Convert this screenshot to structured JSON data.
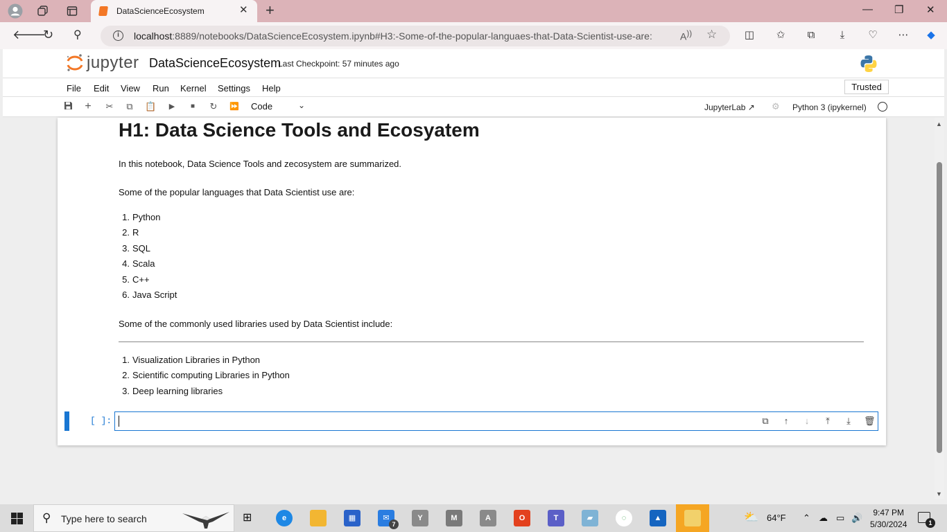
{
  "browser": {
    "tab_title": "DataScienceEcosystem",
    "url_host": "localhost",
    "url_rest": ":8889/notebooks/DataScienceEcosystem.ipynb#H3:-Some-of-the-popular-languaes-that-Data-Scientist-use-are:"
  },
  "jupyter": {
    "logo_word": "jupyter",
    "notebook_name": "DataScienceEcosystem",
    "checkpoint": "Last Checkpoint: 57 minutes ago",
    "menu": [
      "File",
      "Edit",
      "View",
      "Run",
      "Kernel",
      "Settings",
      "Help"
    ],
    "trusted": "Trusted",
    "cell_type": "Code",
    "jupyterlab_link": "JupyterLab",
    "kernel": "Python 3 (ipykernel)"
  },
  "notebook": {
    "title": "H1: Data Science Tools and Ecosyatem",
    "intro": "In this notebook, Data Science Tools and zecosystem are summarized.",
    "languages_heading": "Some of the popular languages that Data Scientist use are:",
    "languages": [
      "Python",
      "R",
      "SQL",
      "Scala",
      "C++",
      "Java Script"
    ],
    "libraries_heading": "Some of the commonly used libraries used by Data Scientist include:",
    "libraries": [
      "Visualization Libraries in Python",
      "Scientific computing Libraries in Python",
      "Deep learning libraries"
    ],
    "prompt": "[ ]:"
  },
  "taskbar": {
    "search_placeholder": "Type here to search",
    "weather": "64°F",
    "time": "9:47 PM",
    "date": "5/30/2024",
    "mail_badge": "7",
    "notif_count": "1",
    "app_y": "Y",
    "app_m": "M",
    "app_a": "A"
  }
}
